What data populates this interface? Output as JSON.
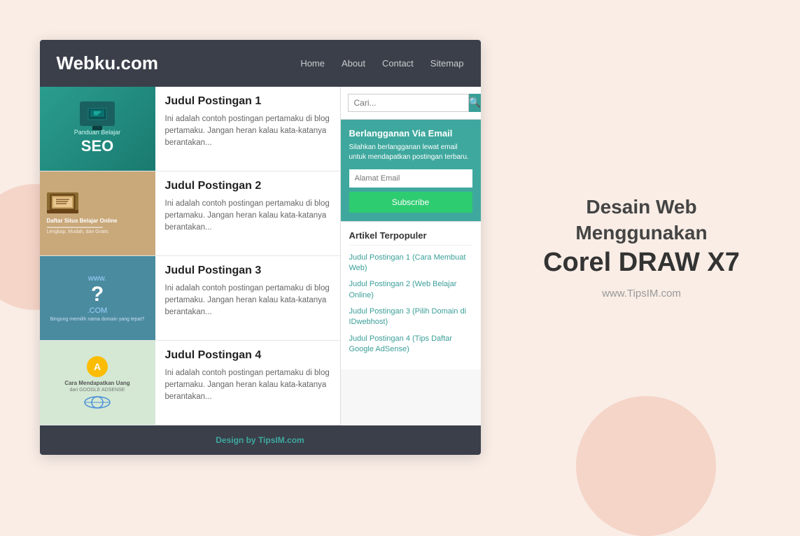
{
  "background": {
    "color": "#f9ede6"
  },
  "website": {
    "header": {
      "logo": "Webku.com",
      "nav": [
        "Home",
        "About",
        "Contact",
        "Sitemap"
      ]
    },
    "posts": [
      {
        "title": "Judul Postingan 1",
        "excerpt": "Ini adalah contoh postingan pertamaku di blog pertamaku. Jangan heran kalau kata-katanya berantakan...",
        "thumb_type": "seo"
      },
      {
        "title": "Judul Postingan 2",
        "excerpt": "Ini adalah contoh postingan pertamaku di blog pertamaku. Jangan heran kalau kata-katanya berantakan...",
        "thumb_type": "daftar"
      },
      {
        "title": "Judul Postingan 3",
        "excerpt": "Ini adalah contoh postingan pertamaku di blog pertamaku. Jangan heran kalau kata-katanya berantakan...",
        "thumb_type": "domain"
      },
      {
        "title": "Judul Postingan 4",
        "excerpt": "Ini adalah contoh postingan pertamaku di blog pertamaku. Jangan heran kalau kata-katanya berantakan...",
        "thumb_type": "adsense"
      }
    ],
    "sidebar": {
      "search_placeholder": "Cari...",
      "subscribe": {
        "title": "Berlangganan Via Email",
        "description": "Silahkan berlangganan lewat email untuk mendapatkan postingan terbaru.",
        "email_placeholder": "Alamat Email",
        "button_label": "Subscribe"
      },
      "popular": {
        "title": "Artikel Terpopuler",
        "items": [
          "Judul Postingan 1 (Cara Membuat Web)",
          "Judul Postingan 2 (Web Belajar Online)",
          "Judul Postingan 3 (Pilih Domain di IDwebhost)",
          "Judul Postingan 4 (Tips Daftar Google AdSense)"
        ]
      }
    },
    "footer": {
      "text_prefix": "Design by ",
      "brand": "TipsIM.com"
    }
  },
  "promo": {
    "line1": "Desain Web Menggunakan",
    "line2": "Corel DRAW X7",
    "url": "www.TipsIM.com"
  }
}
